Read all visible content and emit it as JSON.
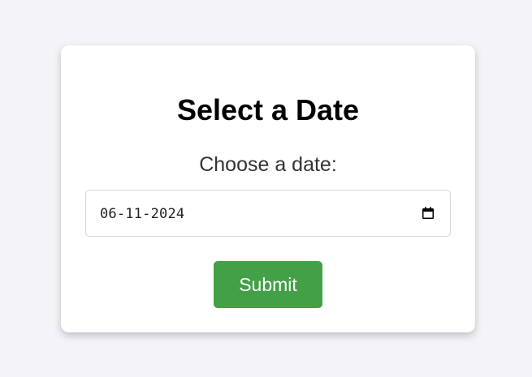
{
  "form": {
    "title": "Select a Date",
    "label": "Choose a date:",
    "date_value": "06-11-2024",
    "submit_label": "Submit"
  },
  "icons": {
    "date_picker": "calendar-icon"
  },
  "colors": {
    "background": "#f4f4f8",
    "card": "#ffffff",
    "submit_button": "#43a047",
    "submit_text": "#ffffff"
  }
}
